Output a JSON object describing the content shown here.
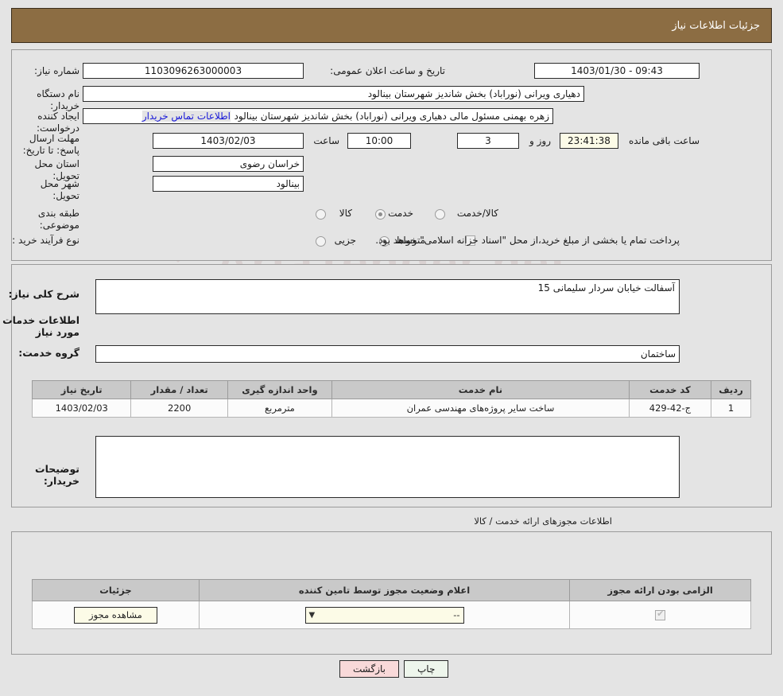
{
  "header": {
    "title": "جزئیات اطلاعات نیاز"
  },
  "form": {
    "need_number_label": "شماره نیاز:",
    "need_number_value": "1103096263000003",
    "announce_label": "تاریخ و ساعت اعلان عمومی:",
    "announce_value": "09:43 - 1403/01/30",
    "buyer_org_label": "نام دستگاه خریدار:",
    "buyer_org_value": "دهیاری ویرانی (نوراباد) بخش شاندیز شهرستان بینالود",
    "requester_label": "ایجاد کننده درخواست:",
    "requester_value": "زهره بهمنی مسئول مالی دهیاری ویرانی (نوراباد) بخش شاندیز شهرستان بینالود",
    "contact_link": "اطلاعات تماس خریدار",
    "deadline_label": "مهلت ارسال پاسخ: تا تاریخ:",
    "deadline_date": "1403/02/03",
    "hour_label": "ساعت",
    "deadline_time": "10:00",
    "days_value": "3",
    "days_unit": "روز و",
    "countdown_value": "23:41:38",
    "countdown_unit": "ساعت باقی مانده",
    "province_label": "استان محل تحویل:",
    "province_value": "خراسان رضوی",
    "city_label": "شهر محل تحویل:",
    "city_value": "بینالود",
    "category_label": "طبقه بندی موضوعی:",
    "category_options": [
      "کالا",
      "خدمت",
      "کالا/خدمت"
    ],
    "category_selected": "خدمت",
    "purchase_type_label": "نوع فرآیند خرید :",
    "purchase_type_options": [
      "جزیی",
      "متوسط"
    ],
    "purchase_type_selected": "متوسط",
    "treasury_checkbox_label": "پرداخت تمام یا بخشی از مبلغ خرید،از محل \"اسناد خزانه اسلامی\" خواهد بود.",
    "treasury_checked": false,
    "general_desc_label": "شرح کلی نیاز:",
    "general_desc_value": "آسفالت خیابان سردار سلیمانی 15",
    "services_heading": "اطلاعات خدمات مورد نیاز",
    "service_group_label": "گروه خدمت:",
    "service_group_value": "ساختمان",
    "buyer_notes_label": "توضیحات خریدار:",
    "buyer_notes_value": ""
  },
  "service_table": {
    "headers": [
      "ردیف",
      "کد خدمت",
      "نام خدمت",
      "واحد اندازه گیری",
      "تعداد / مقدار",
      "تاریخ نیاز"
    ],
    "rows": [
      {
        "row": "1",
        "code": "ج-42-429",
        "name": "ساخت سایر پروژه‌های مهندسی عمران",
        "unit": "مترمربع",
        "quantity": "2200",
        "date": "1403/02/03"
      }
    ]
  },
  "permits": {
    "caption": "اطلاعات مجوزهای ارائه خدمت / کالا",
    "headers": [
      "الزامی بودن ارائه مجوز",
      "اعلام وضعیت مجوز توسط تامین کننده",
      "جزئیات"
    ],
    "rows": [
      {
        "required": true,
        "status_value": "--",
        "details_button": "مشاهده مجوز"
      }
    ]
  },
  "footer": {
    "print_label": "چاپ",
    "back_label": "بازگشت"
  },
  "watermark": {
    "text": "AriaTender.net"
  },
  "colors": {
    "header_brown": "#8c6d43",
    "page_bg": "#e4e4e4",
    "table_header": "#c9c9c9",
    "link_blue": "#1616d8",
    "back_button": "#f9d9d9",
    "print_button": "#eef6ec"
  }
}
